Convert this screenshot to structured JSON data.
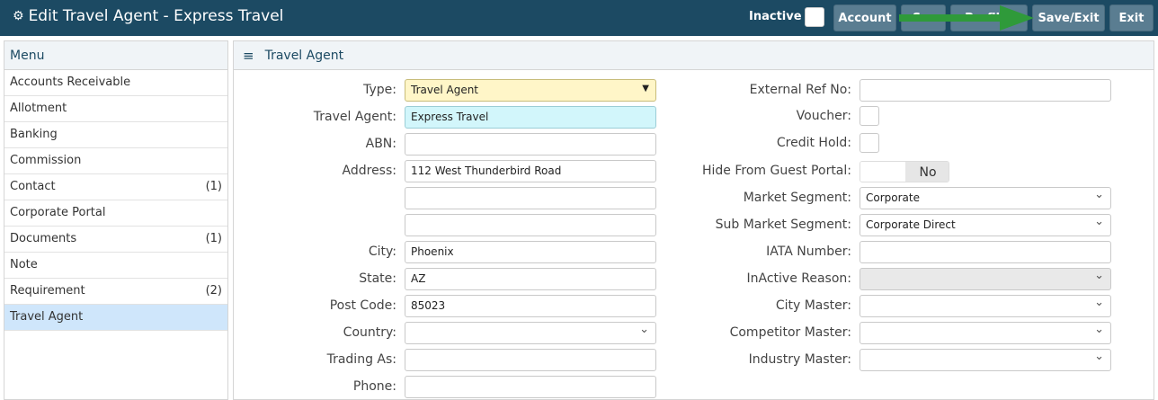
{
  "header": {
    "title": "Edit Travel Agent - Express Travel",
    "inactive_label": "Inactive",
    "buttons": [
      {
        "label": "Account"
      },
      {
        "label": "S..."
      },
      {
        "label": "Profil..."
      },
      {
        "label": "Save/Exit"
      },
      {
        "label": "Exit"
      }
    ]
  },
  "sidebar": {
    "header": "Menu",
    "items": [
      {
        "label": "Accounts Receivable",
        "count": ""
      },
      {
        "label": "Allotment",
        "count": ""
      },
      {
        "label": "Banking",
        "count": ""
      },
      {
        "label": "Commission",
        "count": ""
      },
      {
        "label": "Contact",
        "count": "(1)"
      },
      {
        "label": "Corporate Portal",
        "count": ""
      },
      {
        "label": "Documents",
        "count": "(1)"
      },
      {
        "label": "Note",
        "count": ""
      },
      {
        "label": "Requirement",
        "count": "(2)"
      },
      {
        "label": "Travel Agent",
        "count": ""
      }
    ]
  },
  "panel": {
    "title": "Travel Agent",
    "left": {
      "type_label": "Type:",
      "type_value": "Travel Agent",
      "agent_label": "Travel Agent:",
      "agent_value": "Express Travel",
      "abn_label": "ABN:",
      "abn_value": "",
      "address_label": "Address:",
      "address1": "112 West Thunderbird Road",
      "address2": "",
      "address3": "",
      "city_label": "City:",
      "city_value": "Phoenix",
      "state_label": "State:",
      "state_value": "AZ",
      "post_label": "Post Code:",
      "post_value": "85023",
      "country_label": "Country:",
      "country_value": "",
      "trading_label": "Trading As:",
      "trading_value": "",
      "phone_label": "Phone:",
      "phone_value": ""
    },
    "right": {
      "extref_label": "External Ref No:",
      "extref_value": "",
      "voucher_label": "Voucher:",
      "credithold_label": "Credit Hold:",
      "hideportal_label": "Hide From Guest Portal:",
      "hideportal_value": "No",
      "market_label": "Market Segment:",
      "market_value": "Corporate",
      "submarket_label": "Sub Market Segment:",
      "submarket_value": "Corporate Direct",
      "iata_label": "IATA Number:",
      "iata_value": "",
      "inactive_reason_label": "InActive Reason:",
      "inactive_reason_value": "",
      "citymaster_label": "City Master:",
      "citymaster_value": "",
      "competitor_label": "Competitor Master:",
      "competitor_value": "",
      "industry_label": "Industry Master:",
      "industry_value": ""
    }
  },
  "colors": {
    "topbar": "#1c4a63",
    "button": "#5a7d91",
    "arrow": "#2f9a3a",
    "active_item": "#cfe6fb"
  }
}
